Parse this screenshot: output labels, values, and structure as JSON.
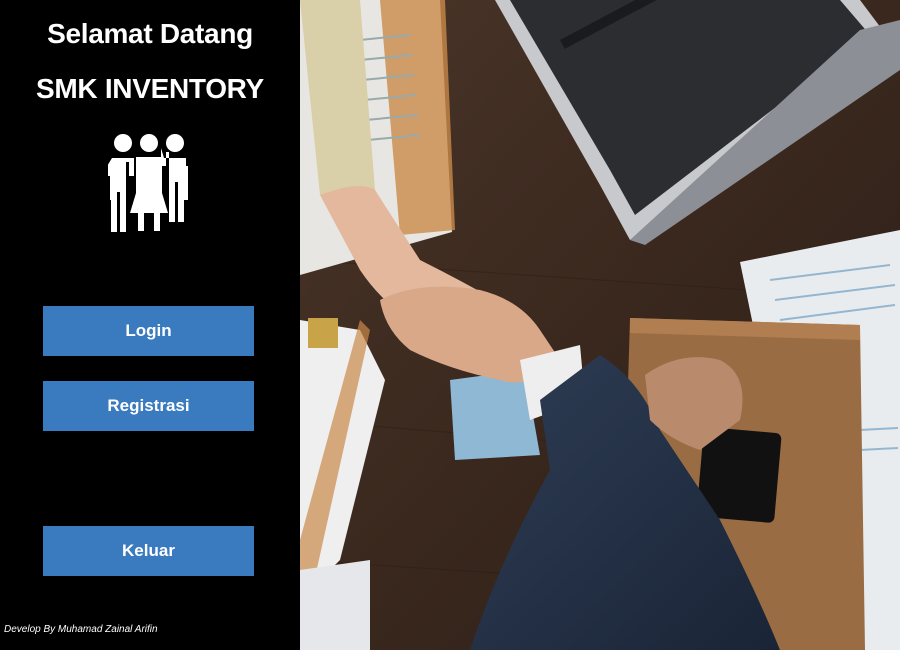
{
  "header": {
    "welcome_line1": "Selamat Datang",
    "welcome_line2": "SMK INVENTORY"
  },
  "logo": {
    "icon": "people-group-icon"
  },
  "buttons": {
    "login_label": "Login",
    "register_label": "Registrasi",
    "exit_label": "Keluar"
  },
  "footer": {
    "credit": "Develop By Muhamad Zainal Arifin"
  },
  "colors": {
    "sidebar_bg": "#000000",
    "button_bg": "#3a7bc0",
    "text": "#ffffff"
  }
}
